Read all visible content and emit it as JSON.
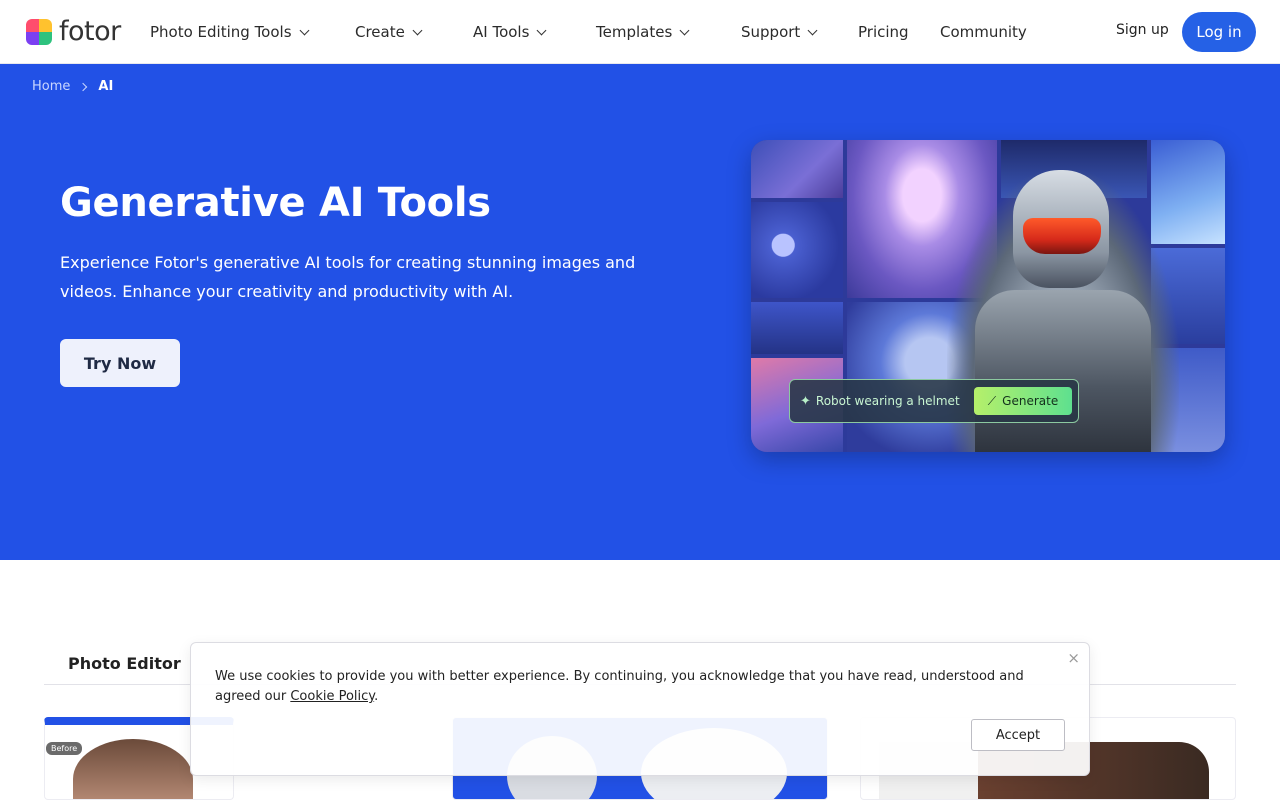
{
  "header": {
    "logo_text": "fotor",
    "nav": [
      {
        "label": "Photo Editing Tools"
      },
      {
        "label": "Create"
      },
      {
        "label": "AI Tools"
      },
      {
        "label": "Templates"
      },
      {
        "label": "Support"
      },
      {
        "label": "Pricing"
      },
      {
        "label": "Community"
      }
    ],
    "signup_label": "Sign up",
    "login_label": "Log in"
  },
  "breadcrumb": {
    "home": "Home",
    "current": "AI"
  },
  "hero": {
    "title": "Generative AI Tools",
    "description": "Experience Fotor's generative AI tools for creating stunning images and videos. Enhance your creativity and productivity with AI.",
    "cta_label": "Try Now",
    "prompt_text": "Robot wearing a helmet",
    "generate_label": "Generate"
  },
  "tabs": {
    "photo_editor": "Photo Editor"
  },
  "cards": {
    "before_badge": "Before"
  },
  "cookie": {
    "text_before": "We use cookies to provide you with better experience. By continuing, you acknowledge that you have read, understood and agreed our ",
    "link_text": "Cookie Policy",
    "text_after": ".",
    "accept_label": "Accept",
    "close_symbol": "×"
  },
  "colors": {
    "brand_blue": "#2251e6",
    "login_blue": "#2561e6",
    "generate_green": "#7ee37f"
  }
}
